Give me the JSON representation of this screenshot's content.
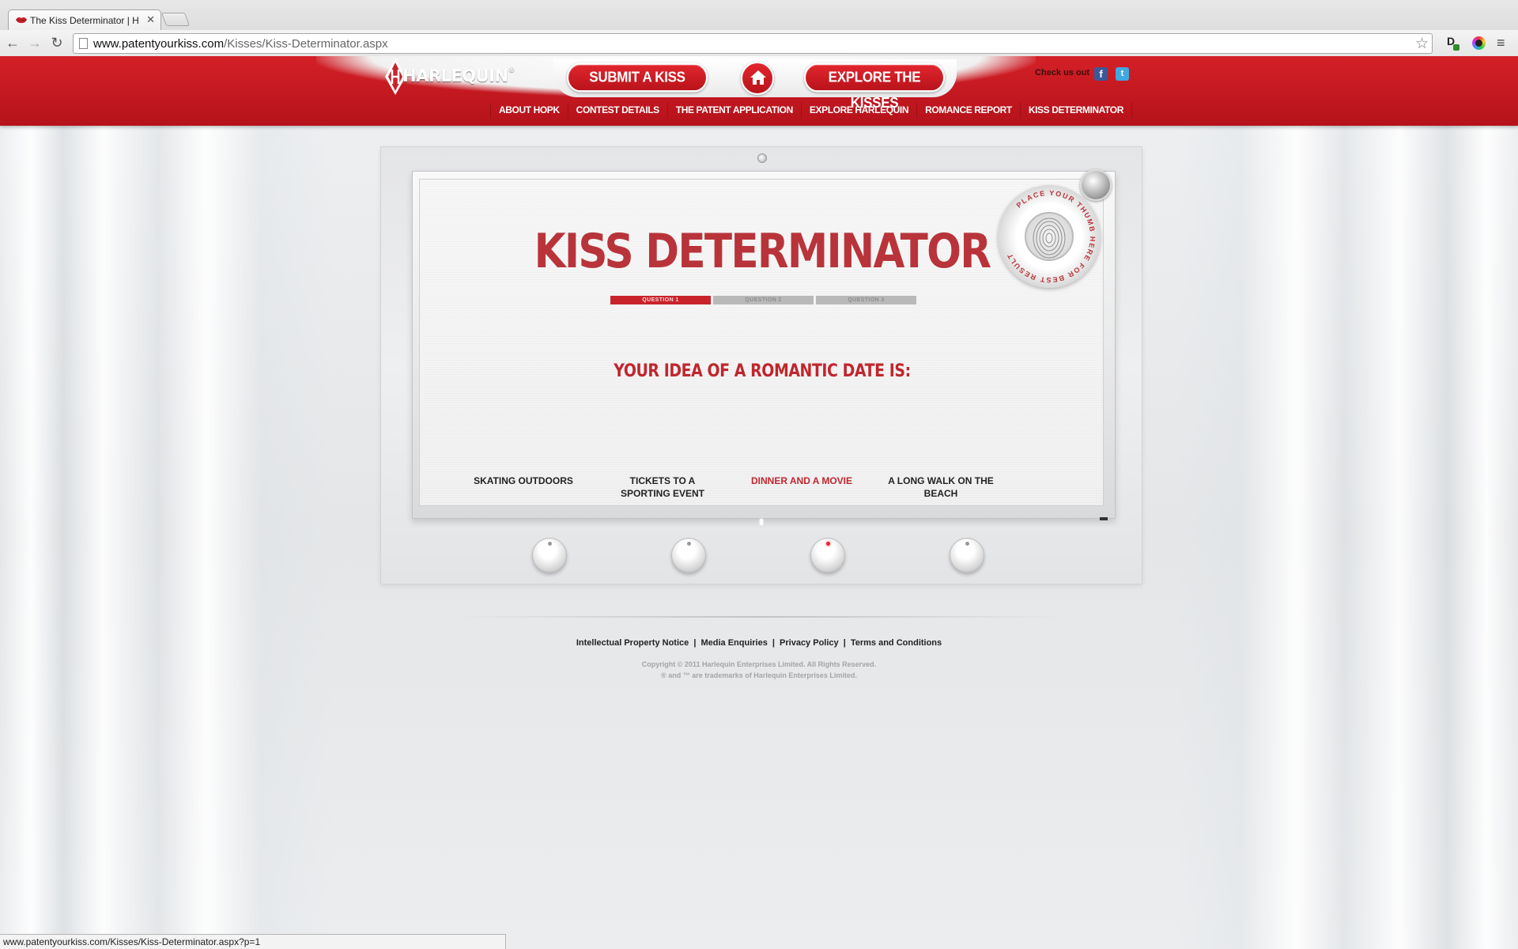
{
  "browser": {
    "tab_title": "The Kiss Determinator | Ha",
    "tab_close": "✕",
    "url_host": "www.patentyourkiss.com",
    "url_path": "/Kisses/Kiss-Determinator.aspx",
    "back_icon": "←",
    "forward_icon": "→",
    "reload_icon": "↻",
    "star_icon": "☆",
    "ext_label": "D",
    "menu_icon": "≡",
    "status_url": "www.patentyourkiss.com/Kisses/Kiss-Determinator.aspx?p=1"
  },
  "header": {
    "logo_text": "HARLEQUIN",
    "logo_mark": "®",
    "submit_label": "SUBMIT A KISS",
    "explore_label": "EXPLORE THE KISSES",
    "check_us_out": "Check us out",
    "facebook_glyph": "f",
    "twitter_glyph": "t",
    "subnav": [
      "ABOUT HOPK",
      "CONTEST DETAILS",
      "THE PATENT APPLICATION",
      "EXPLORE HARLEQUIN",
      "ROMANCE REPORT",
      "KISS DETERMINATOR"
    ]
  },
  "determinator": {
    "title": "KISS DETERMINATOR",
    "progress": [
      "QUESTION 1",
      "QUESTION 2",
      "QUESTION 3"
    ],
    "active_question": 1,
    "question": "YOUR IDEA OF A ROMANTIC DATE IS:",
    "answers": [
      "SKATING OUTDOORS",
      "TICKETS TO A SPORTING EVENT",
      "DINNER AND A MOVIE",
      "A LONG WALK ON THE BEACH"
    ],
    "highlighted_answer": 3,
    "scanner_text": "PLACE YOUR THUMB HERE FOR BEST RESULT"
  },
  "footer": {
    "links": [
      "Intellectual Property Notice",
      "Media Enquiries",
      "Privacy Policy",
      "Terms and Conditions"
    ],
    "separator": "|",
    "copyright": "Copyright © 2011 Harlequin Enterprises Limited. All Rights Reserved.",
    "trademark": "® and ™ are trademarks of Harlequin Enterprises Limited."
  },
  "colors": {
    "brand_red": "#c8232b",
    "highlight_red": "#c0262d"
  }
}
